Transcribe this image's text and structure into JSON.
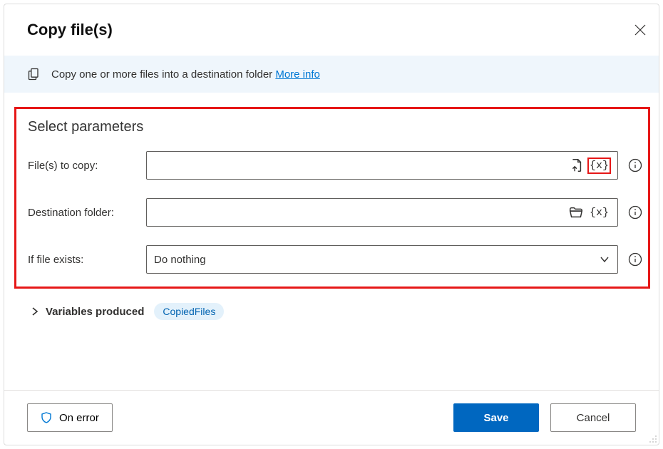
{
  "dialog": {
    "title": "Copy file(s)"
  },
  "banner": {
    "text": "Copy one or more files into a destination folder ",
    "more_info_label": "More info"
  },
  "params": {
    "section_title": "Select parameters",
    "files_to_copy": {
      "label": "File(s) to copy:",
      "value": ""
    },
    "destination_folder": {
      "label": "Destination folder:",
      "value": ""
    },
    "if_file_exists": {
      "label": "If file exists:",
      "selected": "Do nothing"
    },
    "var_token": "{x}"
  },
  "variables": {
    "label": "Variables produced",
    "chips": [
      "CopiedFiles"
    ]
  },
  "footer": {
    "on_error_label": "On error",
    "save_label": "Save",
    "cancel_label": "Cancel"
  }
}
